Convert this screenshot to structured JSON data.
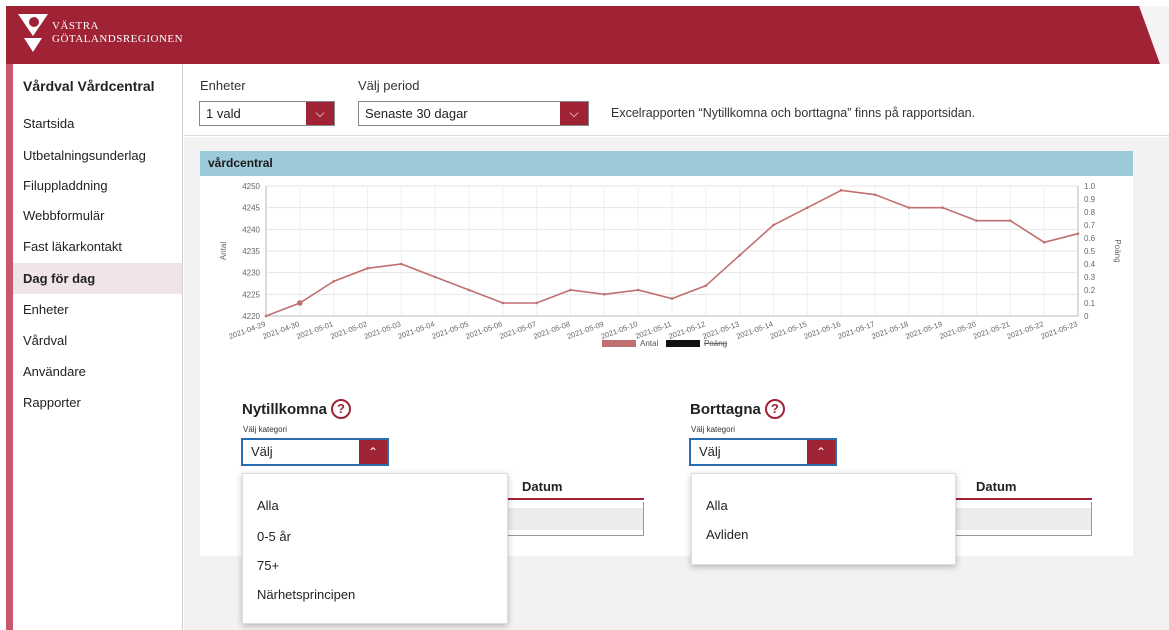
{
  "header": {
    "logo_line1": "VÄSTRA",
    "logo_line2": "GÖTALANDSREGIONEN",
    "brand_color": "#a02235"
  },
  "sidebar": {
    "title": "Vårdval Vårdcentral",
    "items": [
      {
        "label": "Startsida",
        "active": false
      },
      {
        "label": "Utbetalningsunderlag",
        "active": false
      },
      {
        "label": "Filuppladdning",
        "active": false
      },
      {
        "label": "Webbformulär",
        "active": false
      },
      {
        "label": "Fast läkarkontakt",
        "active": false
      },
      {
        "label": "Dag för dag",
        "active": true
      },
      {
        "label": "Enheter",
        "active": false
      },
      {
        "label": "Vårdval",
        "active": false
      },
      {
        "label": "Användare",
        "active": false
      },
      {
        "label": "Rapporter",
        "active": false
      }
    ]
  },
  "filters": {
    "units_label": "Enheter",
    "units_value": "1 vald",
    "period_label": "Välj period",
    "period_value": "Senaste 30 dagar",
    "excel_note": "Excelrapporten “Nytillkomna och borttagna” finns på rapportsidan."
  },
  "card": {
    "title": "vårdcentral"
  },
  "chart_data": {
    "type": "line",
    "categories": [
      "2021-04-29",
      "2021-04-30",
      "2021-05-01",
      "2021-05-02",
      "2021-05-03",
      "2021-05-04",
      "2021-05-05",
      "2021-05-06",
      "2021-05-07",
      "2021-05-08",
      "2021-05-09",
      "2021-05-10",
      "2021-05-11",
      "2021-05-12",
      "2021-05-13",
      "2021-05-14",
      "2021-05-15",
      "2021-05-16",
      "2021-05-17",
      "2021-05-18",
      "2021-05-19",
      "2021-05-20",
      "2021-05-21",
      "2021-05-22",
      "2021-05-23"
    ],
    "series": [
      {
        "name": "Antal",
        "color": "#c07070",
        "values": [
          4220,
          4223,
          4228,
          4231,
          4232,
          4229,
          4226,
          4223,
          4223,
          4226,
          4225,
          4226,
          4224,
          4227,
          4234,
          4241,
          4245,
          4249,
          4248,
          4245,
          4245,
          4242,
          4242,
          4237,
          4239
        ]
      },
      {
        "name": "Poäng",
        "color": "#111111",
        "hidden": true,
        "values": []
      }
    ],
    "ylabel": "Antal",
    "y2label": "Poäng",
    "ylim": [
      4220,
      4250
    ],
    "yticks": [
      4220,
      4225,
      4230,
      4235,
      4240,
      4245,
      4250
    ],
    "y2lim": [
      0,
      1.0
    ],
    "y2ticks": [
      "0",
      "0.1",
      "0.2",
      "0.3",
      "0.4",
      "0.5",
      "0.6",
      "0.7",
      "0.8",
      "0.9",
      "1.0"
    ],
    "grid": true,
    "legend": "bottom-center"
  },
  "nytillkomna": {
    "title": "Nytillkomna",
    "help": "?",
    "sub_label": "Välj kategori",
    "select_value": "Välj",
    "column_header": "Datum",
    "options": [
      "Alla",
      "0-5 år",
      "75+",
      "Närhetsprincipen"
    ]
  },
  "borttagna": {
    "title": "Borttagna",
    "help": "?",
    "sub_label": "Välj kategori",
    "select_value": "Välj",
    "column_header": "Datum",
    "options": [
      "Alla",
      "Avliden"
    ]
  }
}
